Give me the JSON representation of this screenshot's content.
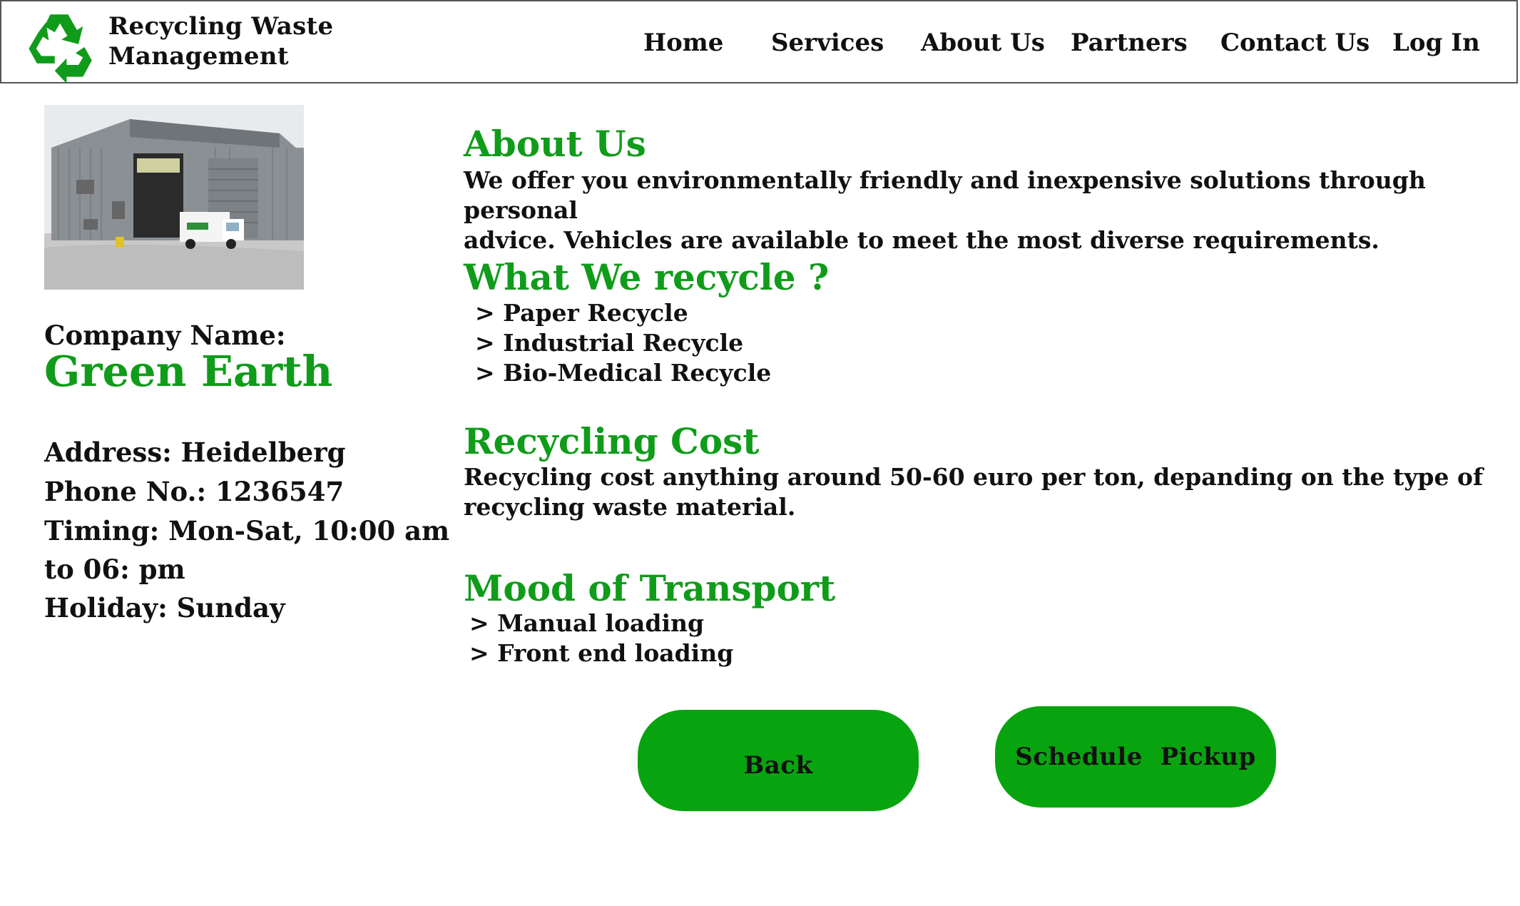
{
  "brand": {
    "line1": "Recycling Waste",
    "line2": "Management",
    "logo_icon": "recycle-icon",
    "logo_color": "#109c1a"
  },
  "nav": [
    {
      "label": "Home"
    },
    {
      "label": "Services"
    },
    {
      "label": "About Us"
    },
    {
      "label": "Partners"
    },
    {
      "label": "Contact Us"
    },
    {
      "label": "Log In"
    }
  ],
  "company": {
    "photo_icon": "recycling-facility-photo",
    "label": "Company Name:",
    "name": "Green Earth",
    "address": "Address: Heidelberg",
    "phone": "Phone No.: 1236547",
    "timing_line1": "Timing: Mon-Sat, 10:00 am",
    "timing_line2": "to 06: pm",
    "holiday": "Holiday: Sunday"
  },
  "about": {
    "heading": "About Us",
    "text_line1": "We offer you environmentally friendly and inexpensive solutions through personal",
    "text_line2": "advice. Vehicles are available to meet the most diverse requirements."
  },
  "recycle": {
    "heading": "What We recycle ?",
    "items": [
      "> Paper Recycle",
      "> Industrial Recycle",
      "> Bio-Medical Recycle"
    ]
  },
  "cost": {
    "heading": "Recycling Cost",
    "text_line1": "Recycling cost anything around 50-60 euro per ton, depanding on the type of",
    "text_line2": "recycling waste material."
  },
  "transport": {
    "heading": "Mood of Transport",
    "items": [
      "> Manual loading",
      "> Front end loading"
    ]
  },
  "buttons": {
    "back": "Back",
    "schedule": "Schedule  Pickup"
  },
  "colors": {
    "accent": "#109c1a",
    "button": "#08a40f"
  }
}
